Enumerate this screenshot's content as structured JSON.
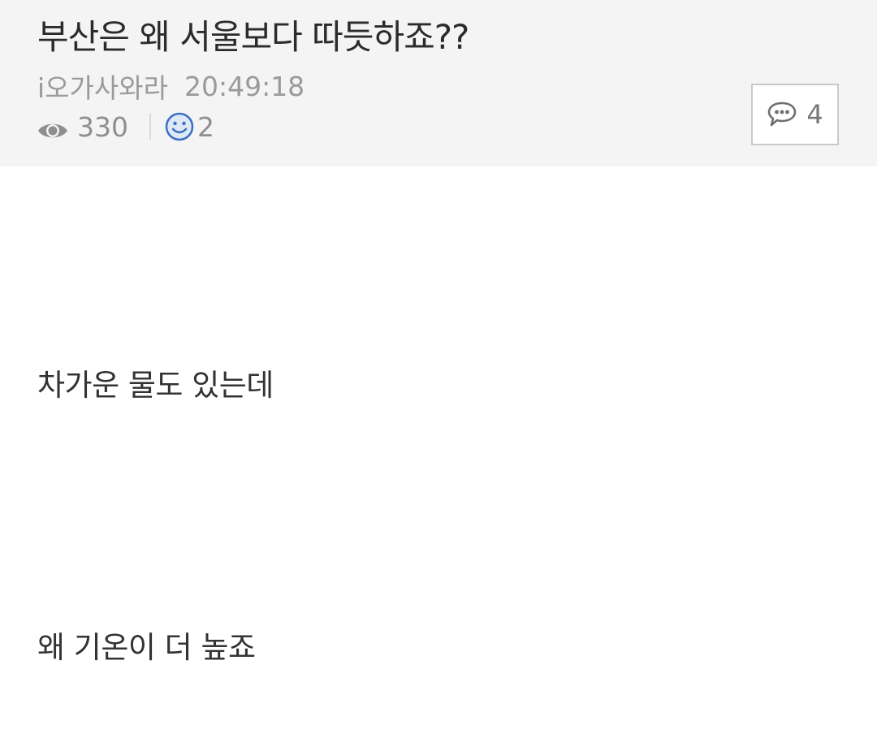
{
  "post": {
    "title": "부산은 왜 서울보다 따듯하죠??",
    "author": "i오가사와라",
    "time": "20:49:18",
    "views": "330",
    "likes": "2",
    "comment_count": "4"
  },
  "content": {
    "paragraphs": [
      "차가운 물도 있는데",
      "왜 기온이 더 높죠"
    ]
  },
  "icons": {
    "views": "eye-icon",
    "likes": "smile-icon",
    "comments": "speech-bubble-icon"
  },
  "colors": {
    "header_bg": "#f4f4f4",
    "title": "#2b2b2b",
    "meta": "#9a9a9a",
    "smile_accent": "#3a6fc4"
  }
}
